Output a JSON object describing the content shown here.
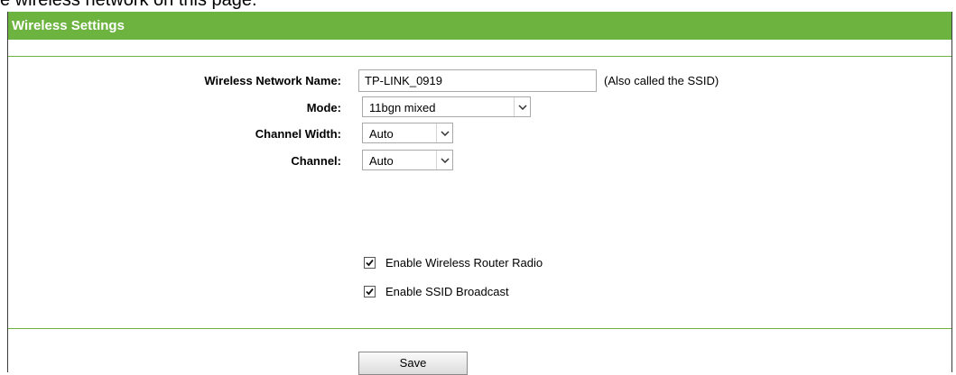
{
  "caption": "e wireless network on this page.",
  "header": {
    "title": "Wireless Settings"
  },
  "form": {
    "ssid_label": "Wireless Network Name:",
    "ssid_value": "TP-LINK_0919",
    "ssid_hint": "(Also called the SSID)",
    "mode_label": "Mode:",
    "mode_value": "11bgn mixed",
    "channel_width_label": "Channel Width:",
    "channel_width_value": "Auto",
    "channel_label": "Channel:",
    "channel_value": "Auto",
    "radio_checkbox": {
      "label": "Enable Wireless Router Radio",
      "checked": true
    },
    "ssid_broadcast_checkbox": {
      "label": "Enable SSID Broadcast",
      "checked": true
    }
  },
  "actions": {
    "save_label": "Save"
  },
  "colors": {
    "header_bg": "#6cb33f",
    "header_text": "#ffffff",
    "separator": "#6cb33f"
  },
  "icons": {
    "dropdown": "chevron-down-icon",
    "check": "check-icon"
  }
}
